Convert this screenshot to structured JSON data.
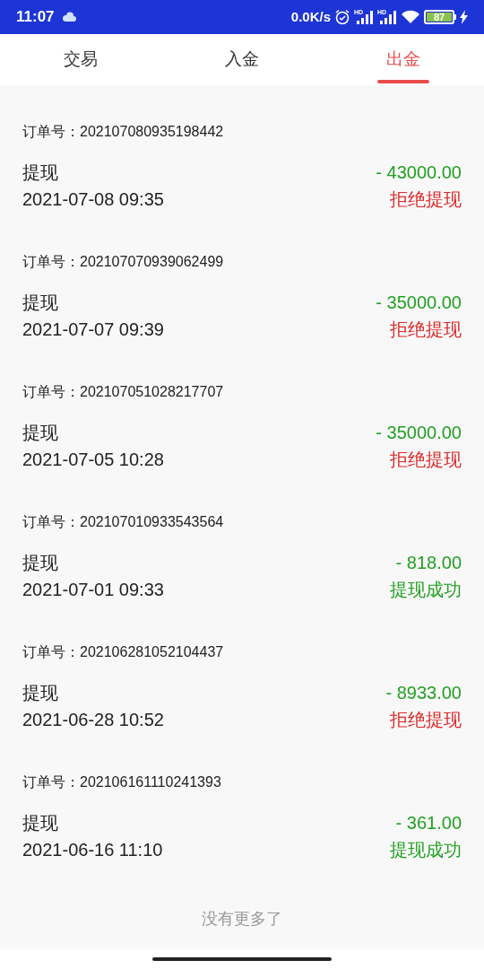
{
  "status_bar": {
    "time": "11:07",
    "speed": "0.0K/s",
    "signal_labels": [
      "HD",
      "HD"
    ],
    "battery": "87"
  },
  "tabs": [
    {
      "label": "交易",
      "selected": false
    },
    {
      "label": "入金",
      "selected": false
    },
    {
      "label": "出金",
      "selected": true
    }
  ],
  "records": [
    {
      "order_label": "订单号：",
      "order_no": "202107080935198442",
      "type": "提现",
      "time": "2021-07-08 09:35",
      "amount": "- 43000.00",
      "status": "拒绝提现",
      "kind": "rejected"
    },
    {
      "order_label": "订单号：",
      "order_no": "202107070939062499",
      "type": "提现",
      "time": "2021-07-07 09:39",
      "amount": "- 35000.00",
      "status": "拒绝提现",
      "kind": "rejected"
    },
    {
      "order_label": "订单号：",
      "order_no": "202107051028217707",
      "type": "提现",
      "time": "2021-07-05 10:28",
      "amount": "- 35000.00",
      "status": "拒绝提现",
      "kind": "rejected"
    },
    {
      "order_label": "订单号：",
      "order_no": "202107010933543564",
      "type": "提现",
      "time": "2021-07-01 09:33",
      "amount": "- 818.00",
      "status": "提现成功",
      "kind": "success"
    },
    {
      "order_label": "订单号：",
      "order_no": "202106281052104437",
      "type": "提现",
      "time": "2021-06-28 10:52",
      "amount": "- 8933.00",
      "status": "拒绝提现",
      "kind": "rejected"
    },
    {
      "order_label": "订单号：",
      "order_no": "202106161110241393",
      "type": "提现",
      "time": "2021-06-16 11:10",
      "amount": "- 361.00",
      "status": "提现成功",
      "kind": "success"
    }
  ],
  "footer": "没有更多了"
}
